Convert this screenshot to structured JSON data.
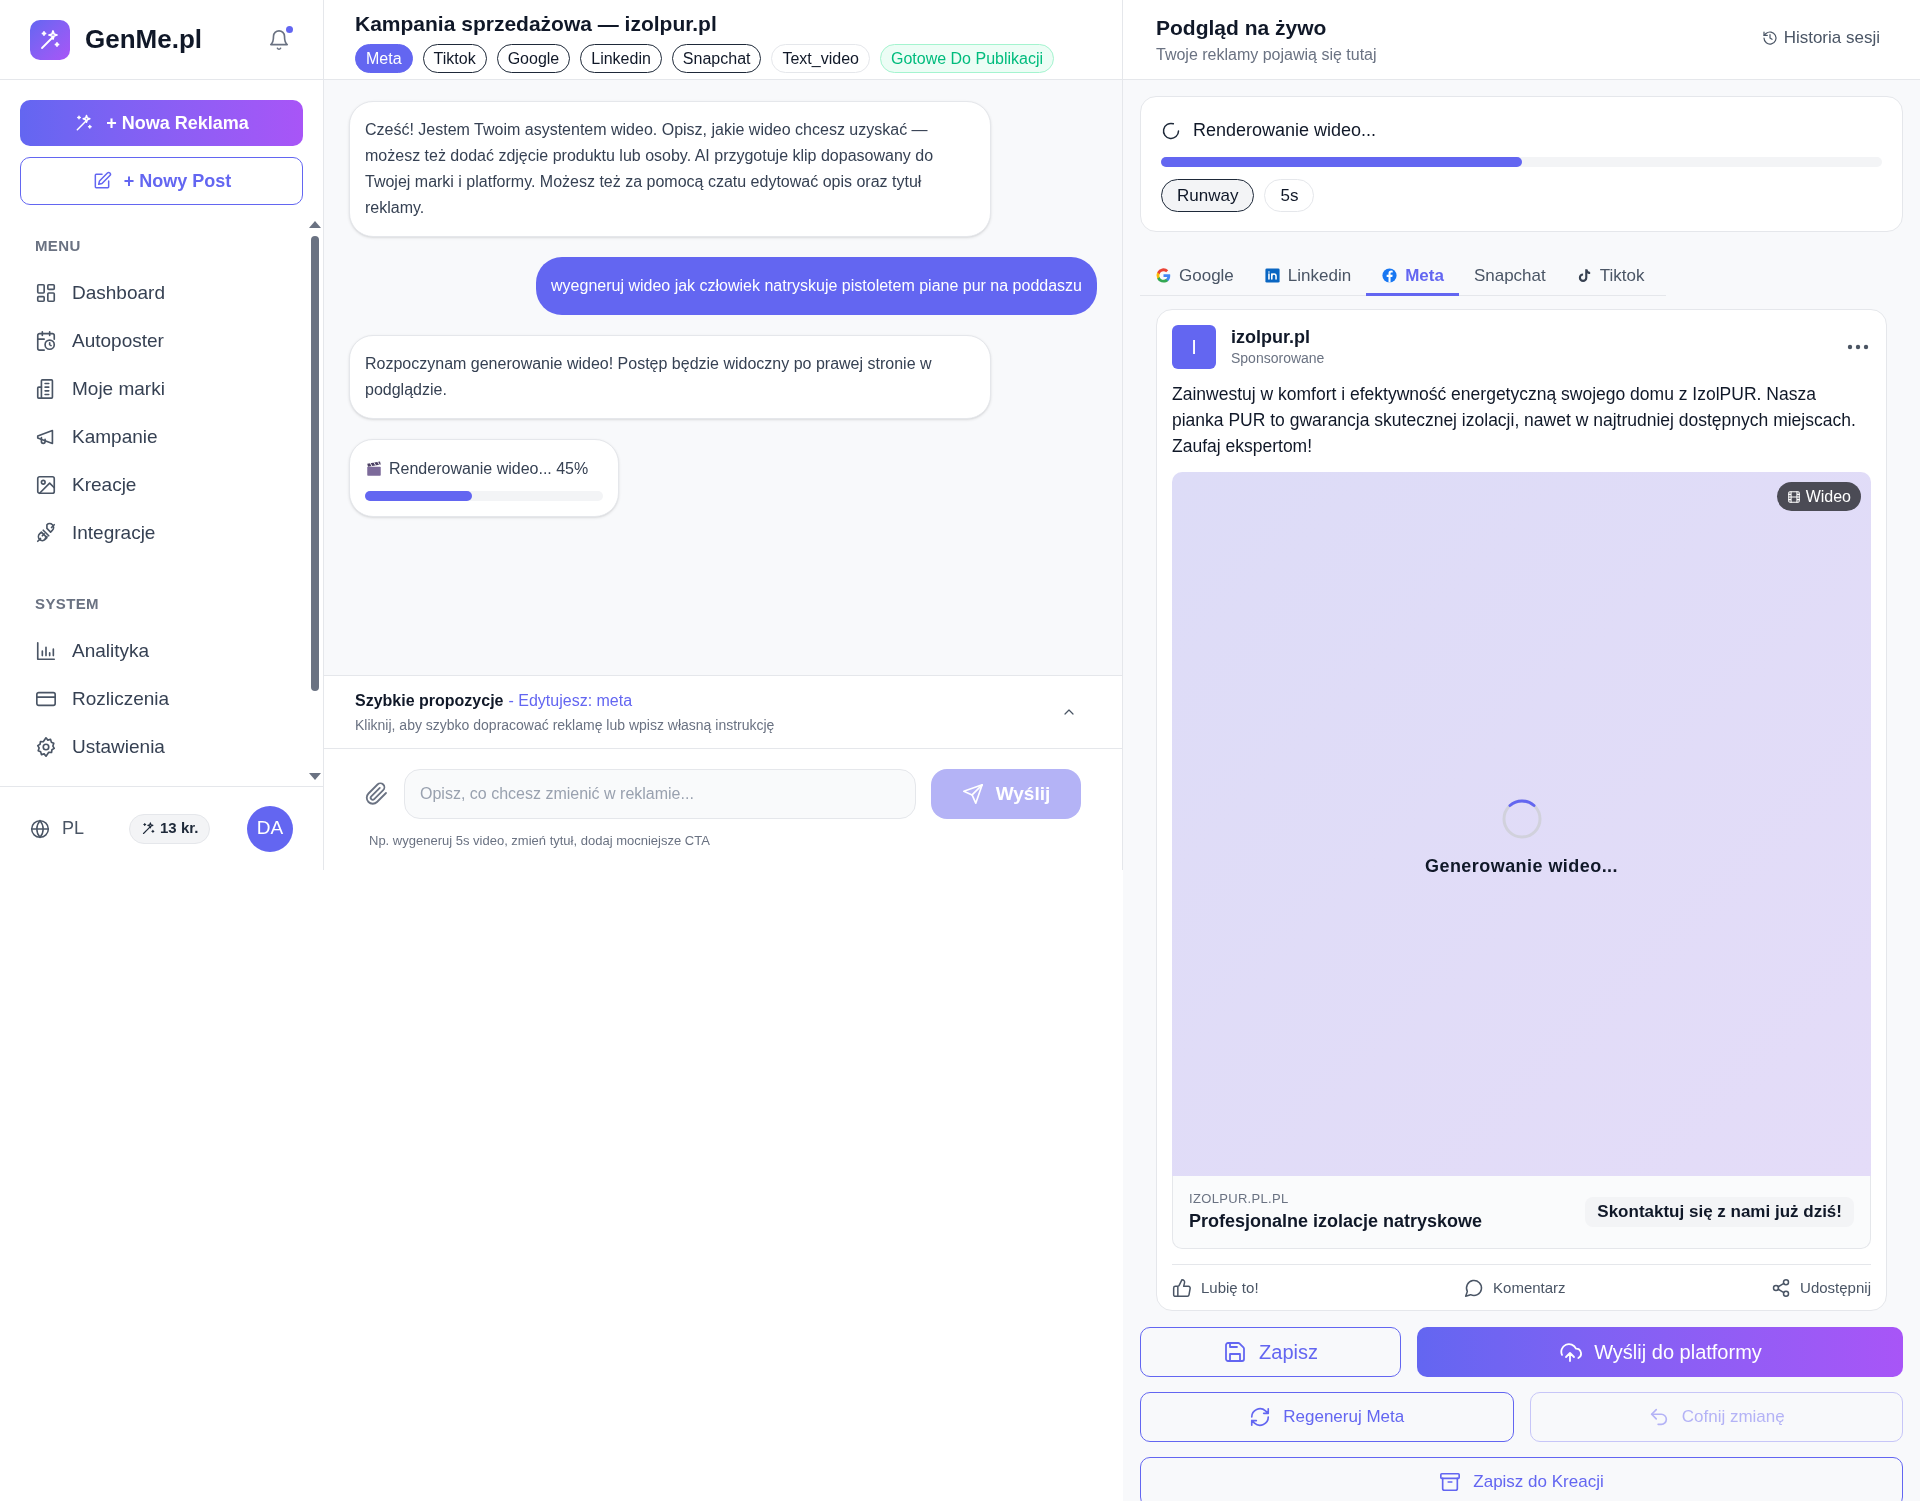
{
  "sidebar": {
    "brand": "GenMe.pl",
    "notifications": {
      "unread": true
    },
    "new_ad_button": "+ Nowa Reklama",
    "new_post_button": "+ Nowy Post",
    "sections": [
      {
        "title": "MENU",
        "items": [
          {
            "label": "Dashboard"
          },
          {
            "label": "Autoposter"
          },
          {
            "label": "Moje marki"
          },
          {
            "label": "Kampanie"
          },
          {
            "label": "Kreacje"
          },
          {
            "label": "Integracje"
          }
        ]
      },
      {
        "title": "SYSTEM",
        "items": [
          {
            "label": "Analityka"
          },
          {
            "label": "Rozliczenia"
          },
          {
            "label": "Ustawienia"
          }
        ]
      }
    ],
    "footer": {
      "language": "PL",
      "credits": "13 kr.",
      "avatar": "DA"
    }
  },
  "chat": {
    "title": "Kampania sprzedażowa — izolpur.pl",
    "tags": [
      {
        "label": "Meta",
        "kind": "platform",
        "selected": true
      },
      {
        "label": "Tiktok",
        "kind": "platform",
        "selected": false
      },
      {
        "label": "Google",
        "kind": "platform",
        "selected": false
      },
      {
        "label": "Linkedin",
        "kind": "platform",
        "selected": false
      },
      {
        "label": "Snapchat",
        "kind": "platform",
        "selected": false
      },
      {
        "label": "Text_video",
        "kind": "format",
        "selected": false
      },
      {
        "label": "Gotowe Do Publikacji",
        "kind": "status",
        "selected": false
      }
    ],
    "messages": [
      {
        "kind": "assistant",
        "text": "Cześć! Jestem Twoim asystentem wideo. Opisz, jakie wideo chcesz uzyskać — możesz też dodać zdjęcie produktu lub osoby. AI przygotuje klip dopasowany do Twojej marki i platformy. Możesz też za pomocą czatu edytować opis oraz tytuł reklamy."
      },
      {
        "kind": "user",
        "text": "wyegneruj wideo jak człowiek natryskuje pistoletem piane pur na poddaszu"
      },
      {
        "kind": "assistant",
        "text": "Rozpoczynam generowanie wideo! Postęp będzie widoczny po prawej stronie w podglądzie."
      },
      {
        "kind": "progress",
        "text": "Renderowanie wideo... 45%",
        "level": 0.45
      }
    ],
    "quick": {
      "title": "Szybkie propozycje",
      "editing": "- Edytujesz: meta",
      "subtitle": "Kliknij, aby szybko dopracować reklamę lub wpisz własną instrukcję",
      "expanded": true
    },
    "input": {
      "placeholder": "Opisz, co chcesz zmienić w reklamie...",
      "send_button": "Wyślij",
      "send_disabled": true,
      "hint": "Np. wygeneruj 5s video, zmień tytuł, dodaj mocniejsze CTA"
    }
  },
  "preview": {
    "title": "Podgląd na żywo",
    "subtitle": "Twoje reklamy pojawią się tutaj",
    "history_button": "Historia sesji",
    "render": {
      "status": "Renderowanie wideo...",
      "level": 0.5,
      "chips": [
        {
          "label": "Runway",
          "selected": true
        },
        {
          "label": "5s",
          "selected": false
        }
      ]
    },
    "tabs": [
      {
        "label": "Google",
        "selected": false
      },
      {
        "label": "Linkedin",
        "selected": false
      },
      {
        "label": "Meta",
        "selected": true
      },
      {
        "label": "Snapchat",
        "selected": false
      },
      {
        "label": "Tiktok",
        "selected": false
      }
    ],
    "post": {
      "avatar": "I",
      "name": "izolpur.pl",
      "sponsored": "Sponsorowane",
      "text": "Zainwestuj w komfort i efektywność energetyczną swojego domu z IzolPUR. Nasza pianka PUR to gwarancja skutecznej izolacji, nawet w najtrudniej dostępnych miejscach. Zaufaj ekspertom!",
      "media_badge": "Wideo",
      "media_status": "Generowanie wideo...",
      "domain": "IZOLPUR.PL.PL",
      "headline": "Profesjonalne izolacje natryskowe",
      "cta": "Skontaktuj się z nami już dziś!",
      "actions": [
        "Lubię to!",
        "Komentarz",
        "Udostępnij"
      ]
    },
    "buttons": [
      {
        "label": "Zapisz",
        "kind": "outline",
        "disabled": false
      },
      {
        "label": "Wyślij do platformy",
        "kind": "primary",
        "disabled": false
      },
      {
        "label": "Regeneruj Meta",
        "kind": "outline",
        "disabled": false
      },
      {
        "label": "Cofnij zmianę",
        "kind": "outline",
        "disabled": true
      },
      {
        "label": "Zapisz do Kreacji",
        "kind": "outline",
        "disabled": false
      }
    ]
  }
}
